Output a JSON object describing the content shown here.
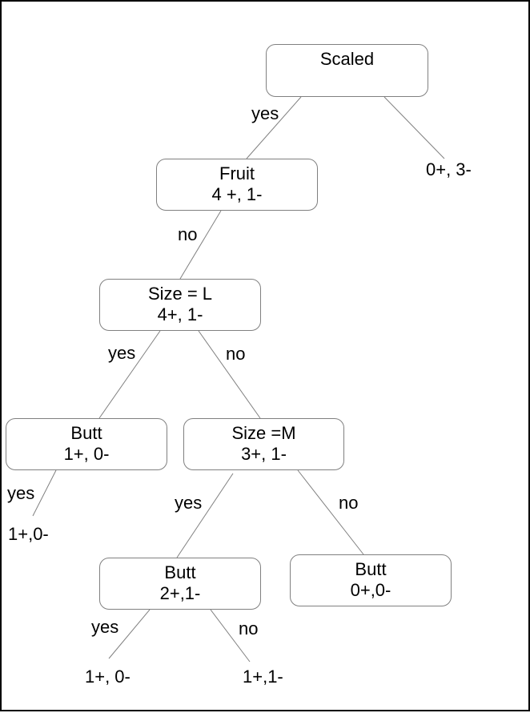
{
  "diagram": {
    "type": "decision-tree",
    "line_color": "#808080",
    "border_color": "#000000",
    "nodes": {
      "root": {
        "title": "Scaled",
        "counts": ""
      },
      "fruit": {
        "title": "Fruit",
        "counts": "4 +, 1-"
      },
      "size_l": {
        "title": "Size = L",
        "counts": "4+, 1-"
      },
      "butt_a": {
        "title": "Butt",
        "counts": "1+, 0-"
      },
      "size_m": {
        "title": "Size =M",
        "counts": "3+, 1-"
      },
      "butt_b": {
        "title": "Butt",
        "counts": "2+,1-"
      },
      "butt_c": {
        "title": "Butt",
        "counts": "0+,0-"
      }
    },
    "leaves": {
      "root_no": "0+, 3-",
      "butt_a_yes": "1+,0-",
      "butt_b_yes": "1+, 0-",
      "butt_b_no": "1+,1-"
    },
    "edge_labels": {
      "root_fruit": "yes",
      "fruit_size_l": "no",
      "size_l_butt_a": "yes",
      "size_l_size_m": "no",
      "butt_a_leaf": "yes",
      "size_m_butt_b": "yes",
      "size_m_butt_c": "no",
      "butt_b_leaf_yes": "yes",
      "butt_b_leaf_no": "no"
    }
  }
}
